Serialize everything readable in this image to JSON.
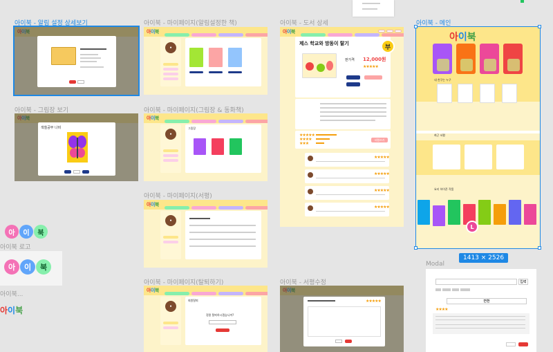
{
  "frames": {
    "notice_detail": "아이북 - 알림 설정 상세보기",
    "picture_view": "아이북 - 그림장 보기",
    "mypage_alarm": "아이북 - 마이페이지(알림설정한 책)",
    "mypage_picture": "아이북 - 마이페이지(그림장 & 동화책)",
    "mypage_review": "아이북 - 마이페이지(서평)",
    "mypage_withdraw": "아이북 - 마이페이지(탈퇴하기)",
    "book_detail": "아이북 - 도서 상세",
    "review_edit": "아이북 - 서평수정",
    "main": "아이북 - 메인",
    "modal": "Modal",
    "logo_label_1": "아이북 로고",
    "logo_label_2": "아이북..."
  },
  "logo": {
    "c1": "아",
    "c2": "이",
    "c3": "북",
    "full": "아이북"
  },
  "selection_size": "1413 × 2526",
  "book_detail": {
    "title": "제스 학교와 방동이 탈기",
    "badge": "부",
    "price_label": "판가격",
    "price": "12,000원",
    "review_button": "서평쓰기"
  },
  "main_preview": {
    "section1": "내 친구는 누구",
    "section2": "최근 서평",
    "section3": "요리 하이픈 작품",
    "avatar_badge": "L"
  },
  "picture_view": {
    "title": "색칠공부 나비"
  },
  "mypage_picture": {
    "tab": "그림장"
  },
  "mypage_withdraw": {
    "title": "회원탈퇴",
    "question": "정말 탈퇴하시겠습니까?"
  },
  "modal": {
    "button": "입력",
    "secondary": "변환"
  },
  "colors": {
    "selection": "#1e88e5",
    "brand_red": "#e53935",
    "header_yellow": "#fde68a"
  }
}
